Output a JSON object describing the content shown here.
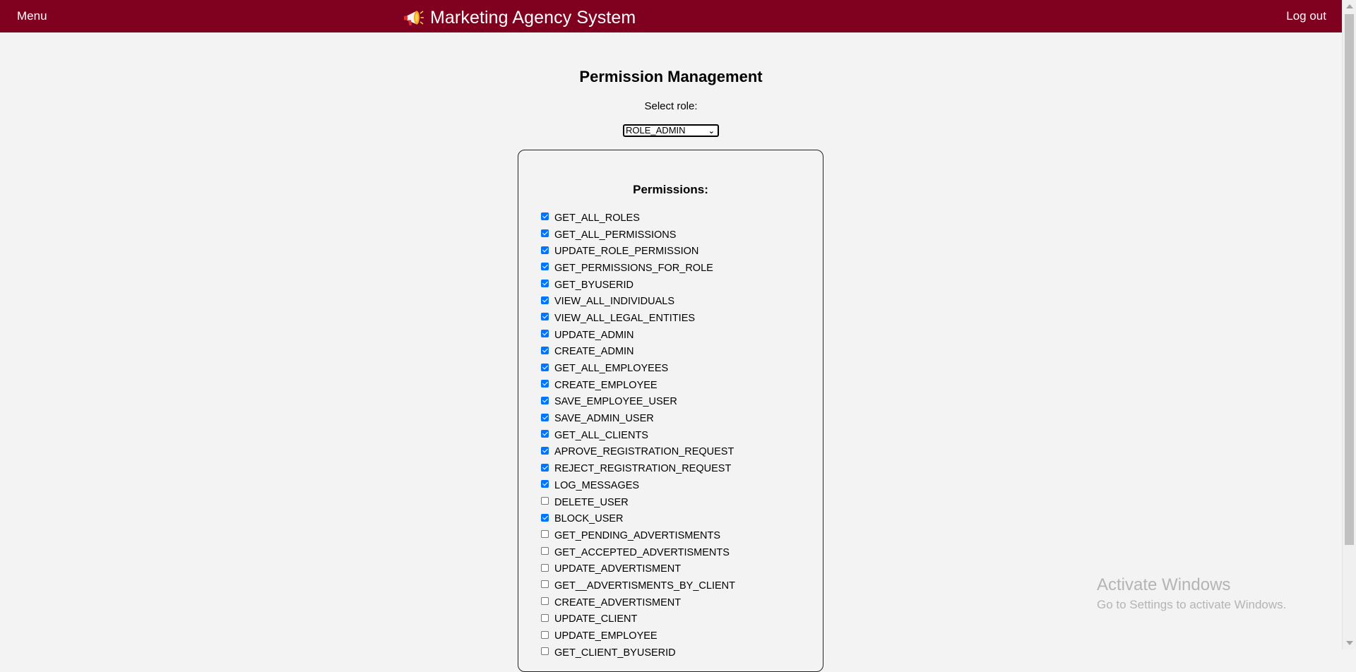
{
  "header": {
    "menu_label": "Menu",
    "app_title": "Marketing Agency System",
    "logout_label": "Log out",
    "logo_icon": "megaphone-icon",
    "bar_color": "#800020"
  },
  "page": {
    "title": "Permission Management",
    "role_label": "Select role:",
    "selected_role": "ROLE_ADMIN"
  },
  "permissions": {
    "heading": "Permissions:",
    "items": [
      {
        "name": "GET_ALL_ROLES",
        "checked": true
      },
      {
        "name": "GET_ALL_PERMISSIONS",
        "checked": true
      },
      {
        "name": "UPDATE_ROLE_PERMISSION",
        "checked": true
      },
      {
        "name": "GET_PERMISSIONS_FOR_ROLE",
        "checked": true
      },
      {
        "name": "GET_BYUSERID",
        "checked": true
      },
      {
        "name": "VIEW_ALL_INDIVIDUALS",
        "checked": true
      },
      {
        "name": "VIEW_ALL_LEGAL_ENTITIES",
        "checked": true
      },
      {
        "name": "UPDATE_ADMIN",
        "checked": true
      },
      {
        "name": "CREATE_ADMIN",
        "checked": true
      },
      {
        "name": "GET_ALL_EMPLOYEES",
        "checked": true
      },
      {
        "name": "CREATE_EMPLOYEE",
        "checked": true
      },
      {
        "name": "SAVE_EMPLOYEE_USER",
        "checked": true
      },
      {
        "name": "SAVE_ADMIN_USER",
        "checked": true
      },
      {
        "name": "GET_ALL_CLIENTS",
        "checked": true
      },
      {
        "name": "APROVE_REGISTRATION_REQUEST",
        "checked": true
      },
      {
        "name": "REJECT_REGISTRATION_REQUEST",
        "checked": true
      },
      {
        "name": "LOG_MESSAGES",
        "checked": true
      },
      {
        "name": "DELETE_USER",
        "checked": false
      },
      {
        "name": "BLOCK_USER",
        "checked": true
      },
      {
        "name": "GET_PENDING_ADVERTISMENTS",
        "checked": false
      },
      {
        "name": "GET_ACCEPTED_ADVERTISMENTS",
        "checked": false
      },
      {
        "name": "UPDATE_ADVERTISMENT",
        "checked": false
      },
      {
        "name": "GET__ADVERTISMENTS_BY_CLIENT",
        "checked": false
      },
      {
        "name": "CREATE_ADVERTISMENT",
        "checked": false
      },
      {
        "name": "UPDATE_CLIENT",
        "checked": false
      },
      {
        "name": "UPDATE_EMPLOYEE",
        "checked": false
      },
      {
        "name": "GET_CLIENT_BYUSERID",
        "checked": false
      }
    ]
  },
  "os_watermark": {
    "title": "Activate Windows",
    "subtitle": "Go to Settings to activate Windows."
  }
}
